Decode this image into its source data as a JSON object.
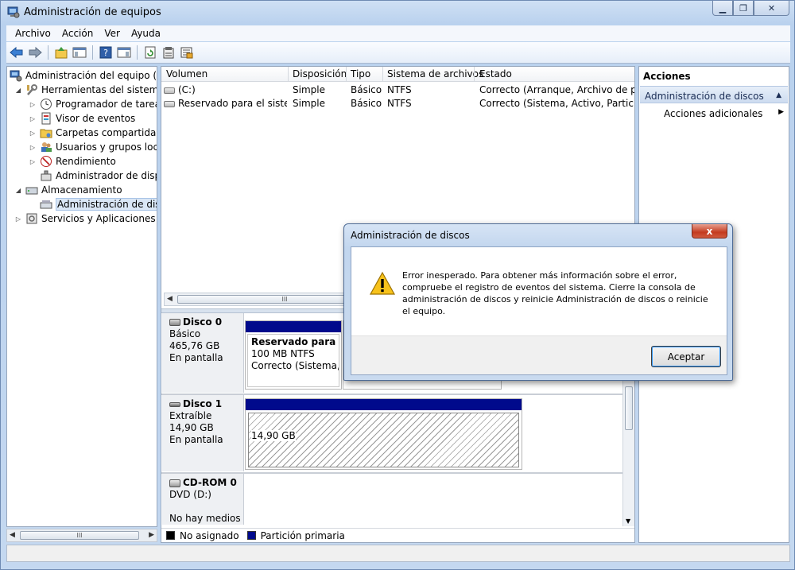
{
  "window": {
    "title": "Administración de equipos"
  },
  "menubar": {
    "items": [
      "Archivo",
      "Acción",
      "Ver",
      "Ayuda"
    ]
  },
  "toolbar": {
    "icons": [
      "back-arrow-icon",
      "forward-arrow-icon",
      "up-folder-icon",
      "show-hide-console-tree-icon",
      "help-icon",
      "show-hide-action-pane-icon",
      "refresh-icon",
      "properties-icon",
      "export-list-icon"
    ]
  },
  "tree": {
    "items": [
      {
        "label": "Administración del equipo (loc",
        "icon": "computer-management-icon",
        "expander": ""
      },
      {
        "label": "Herramientas del sistema",
        "icon": "tools-icon",
        "expander": "◢"
      },
      {
        "label": "Programador de tareas",
        "icon": "clock-icon",
        "expander": "▷"
      },
      {
        "label": "Visor de eventos",
        "icon": "event-viewer-icon",
        "expander": "▷"
      },
      {
        "label": "Carpetas compartidas",
        "icon": "shared-folder-icon",
        "expander": "▷"
      },
      {
        "label": "Usuarios y grupos locale",
        "icon": "users-icon",
        "expander": "▷"
      },
      {
        "label": "Rendimiento",
        "icon": "performance-icon",
        "expander": "▷"
      },
      {
        "label": "Administrador de dispo",
        "icon": "device-manager-icon",
        "expander": ""
      },
      {
        "label": "Almacenamiento",
        "icon": "storage-icon",
        "expander": "◢"
      },
      {
        "label": "Administración de disco",
        "icon": "disk-management-icon",
        "expander": ""
      },
      {
        "label": "Servicios y Aplicaciones",
        "icon": "services-icon",
        "expander": "▷"
      }
    ],
    "scroll_thumb": "III"
  },
  "volumes": {
    "columns": [
      "Volumen",
      "Disposición",
      "Tipo",
      "Sistema de archivos",
      "Estado"
    ],
    "rows": [
      {
        "volumen": "(C:)",
        "disposicion": "Simple",
        "tipo": "Básico",
        "sistema": "NTFS",
        "estado": "Correcto (Arranque, Archivo de pagin"
      },
      {
        "volumen": "Reservado para el sistema",
        "disposicion": "Simple",
        "tipo": "Básico",
        "sistema": "NTFS",
        "estado": "Correcto (Sistema, Activo, Partición p"
      }
    ],
    "scroll_thumb": "III"
  },
  "disks": [
    {
      "name": "Disco 0",
      "type": "Básico",
      "size": "465,76 GB",
      "status": "En pantalla",
      "partition": {
        "name": "Reservado para el s",
        "size": "100 MB NTFS",
        "status": "Correcto (Sistema, A"
      }
    },
    {
      "name": "Disco 1",
      "type": "Extraíble",
      "size": "14,90 GB",
      "status": "En pantalla",
      "partition": {
        "size": "14,90 GB"
      }
    },
    {
      "name": "CD-ROM 0",
      "type": "DVD (D:)",
      "status": "No hay medios"
    }
  ],
  "legend": [
    {
      "label": "No asignado",
      "color": "#000000"
    },
    {
      "label": "Partición primaria",
      "color": "#000a8c"
    }
  ],
  "actions": {
    "title": "Acciones",
    "section": "Administración de discos",
    "item": "Acciones adicionales"
  },
  "dialog": {
    "title": "Administración de discos",
    "message": "Error inesperado. Para obtener más información sobre el error, compruebe el registro de eventos del sistema. Cierre la consola de administración de discos y reinicie Administración de discos o reinicie el equipo.",
    "button": "Aceptar",
    "close": "x"
  }
}
